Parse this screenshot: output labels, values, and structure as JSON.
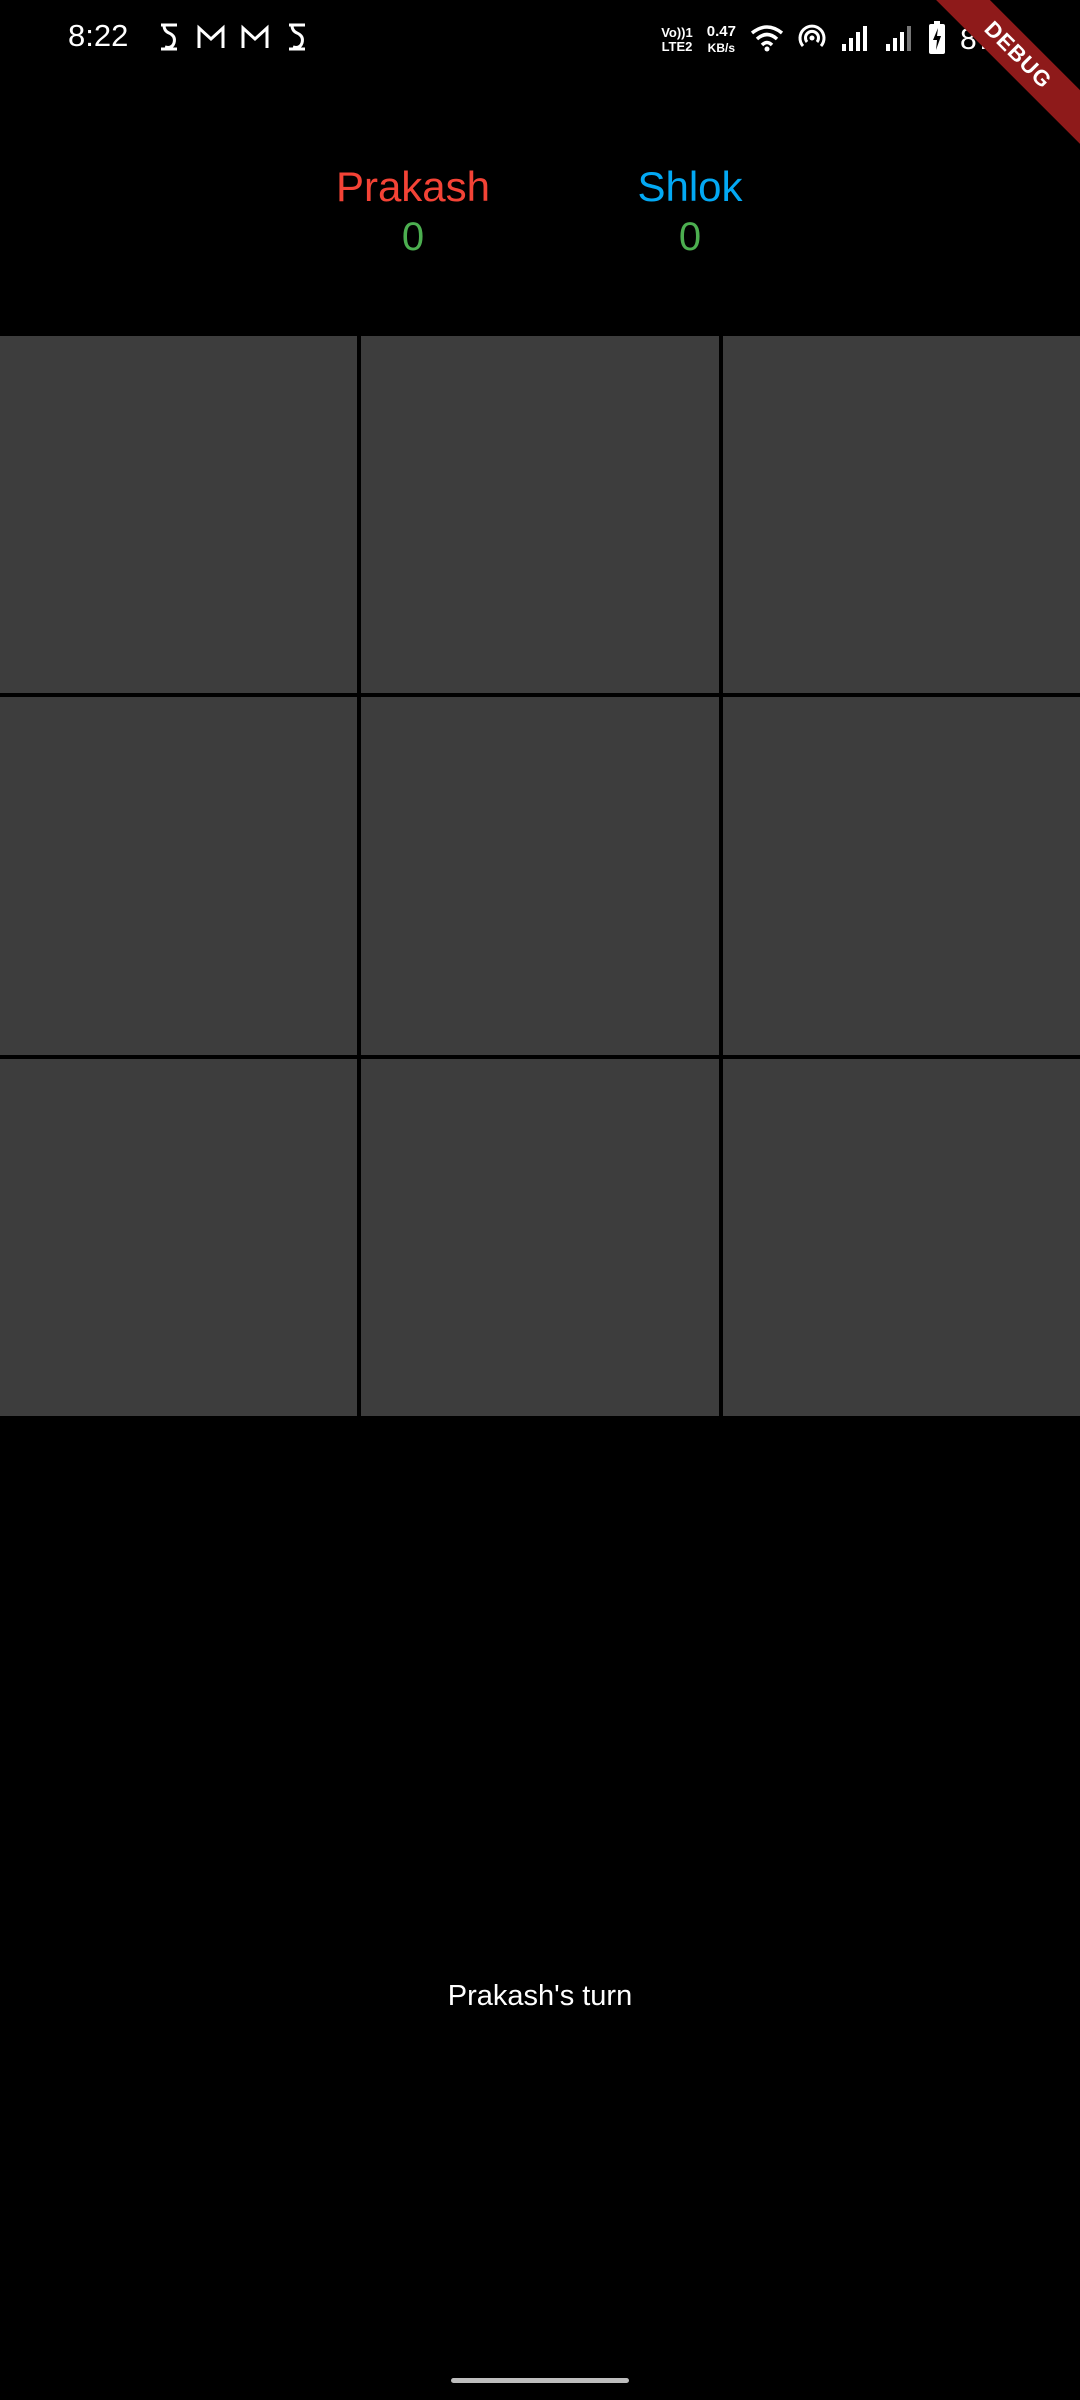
{
  "status_bar": {
    "time": "8:22",
    "volte_line1": "Vo))1",
    "volte_line2": "LTE2",
    "net_speed_value": "0.47",
    "net_speed_unit": "KB/s",
    "battery_percent": "87%",
    "icons": [
      "s-notification-icon",
      "gmail-icon",
      "gmail-icon",
      "s-notification-icon",
      "wifi-icon",
      "hotspot-icon",
      "signal-icon",
      "signal-icon",
      "battery-charging-icon"
    ]
  },
  "debug_banner": "DEBUG",
  "scoreboard": {
    "player1": {
      "name": "Prakash",
      "score": "0",
      "color": "#f44336"
    },
    "player2": {
      "name": "Shlok",
      "score": "0",
      "color": "#03a9f4"
    },
    "score_color": "#4caf50"
  },
  "board": {
    "cells": [
      "",
      "",
      "",
      "",
      "",
      "",
      "",
      "",
      ""
    ],
    "cell_color": "#3d3d3d"
  },
  "turn_text": "Prakash's turn"
}
